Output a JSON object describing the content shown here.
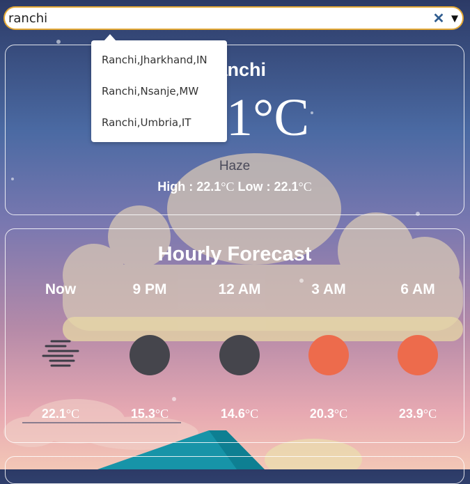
{
  "search": {
    "value": "ranchi",
    "clear_icon": "close-icon",
    "dropdown_icon": "chevron-down-icon"
  },
  "suggestions": [
    "Ranchi,Jharkhand,IN",
    "Ranchi,Nsanje,MW",
    "Ranchi,Umbria,IT"
  ],
  "current": {
    "city": "Ranchi",
    "temperature": "22.1",
    "unit": "°C",
    "condition": "Haze",
    "high_label": "High : ",
    "high": "22.1",
    "low_label": "Low : ",
    "low": "22.1"
  },
  "hourly": {
    "title": "Hourly Forecast",
    "items": [
      {
        "time": "Now",
        "temp": "22.1",
        "icon": "haze-icon",
        "color": "#3c3c46"
      },
      {
        "time": "9 PM",
        "temp": "15.3",
        "icon": "moon-icon",
        "color": "#45454c"
      },
      {
        "time": "12 AM",
        "temp": "14.6",
        "icon": "moon-icon",
        "color": "#45454c"
      },
      {
        "time": "3 AM",
        "temp": "20.3",
        "icon": "sun-icon",
        "color": "#ed6b4c"
      },
      {
        "time": "6 AM",
        "temp": "23.9",
        "icon": "sun-icon",
        "color": "#ed6b4c"
      }
    ]
  }
}
